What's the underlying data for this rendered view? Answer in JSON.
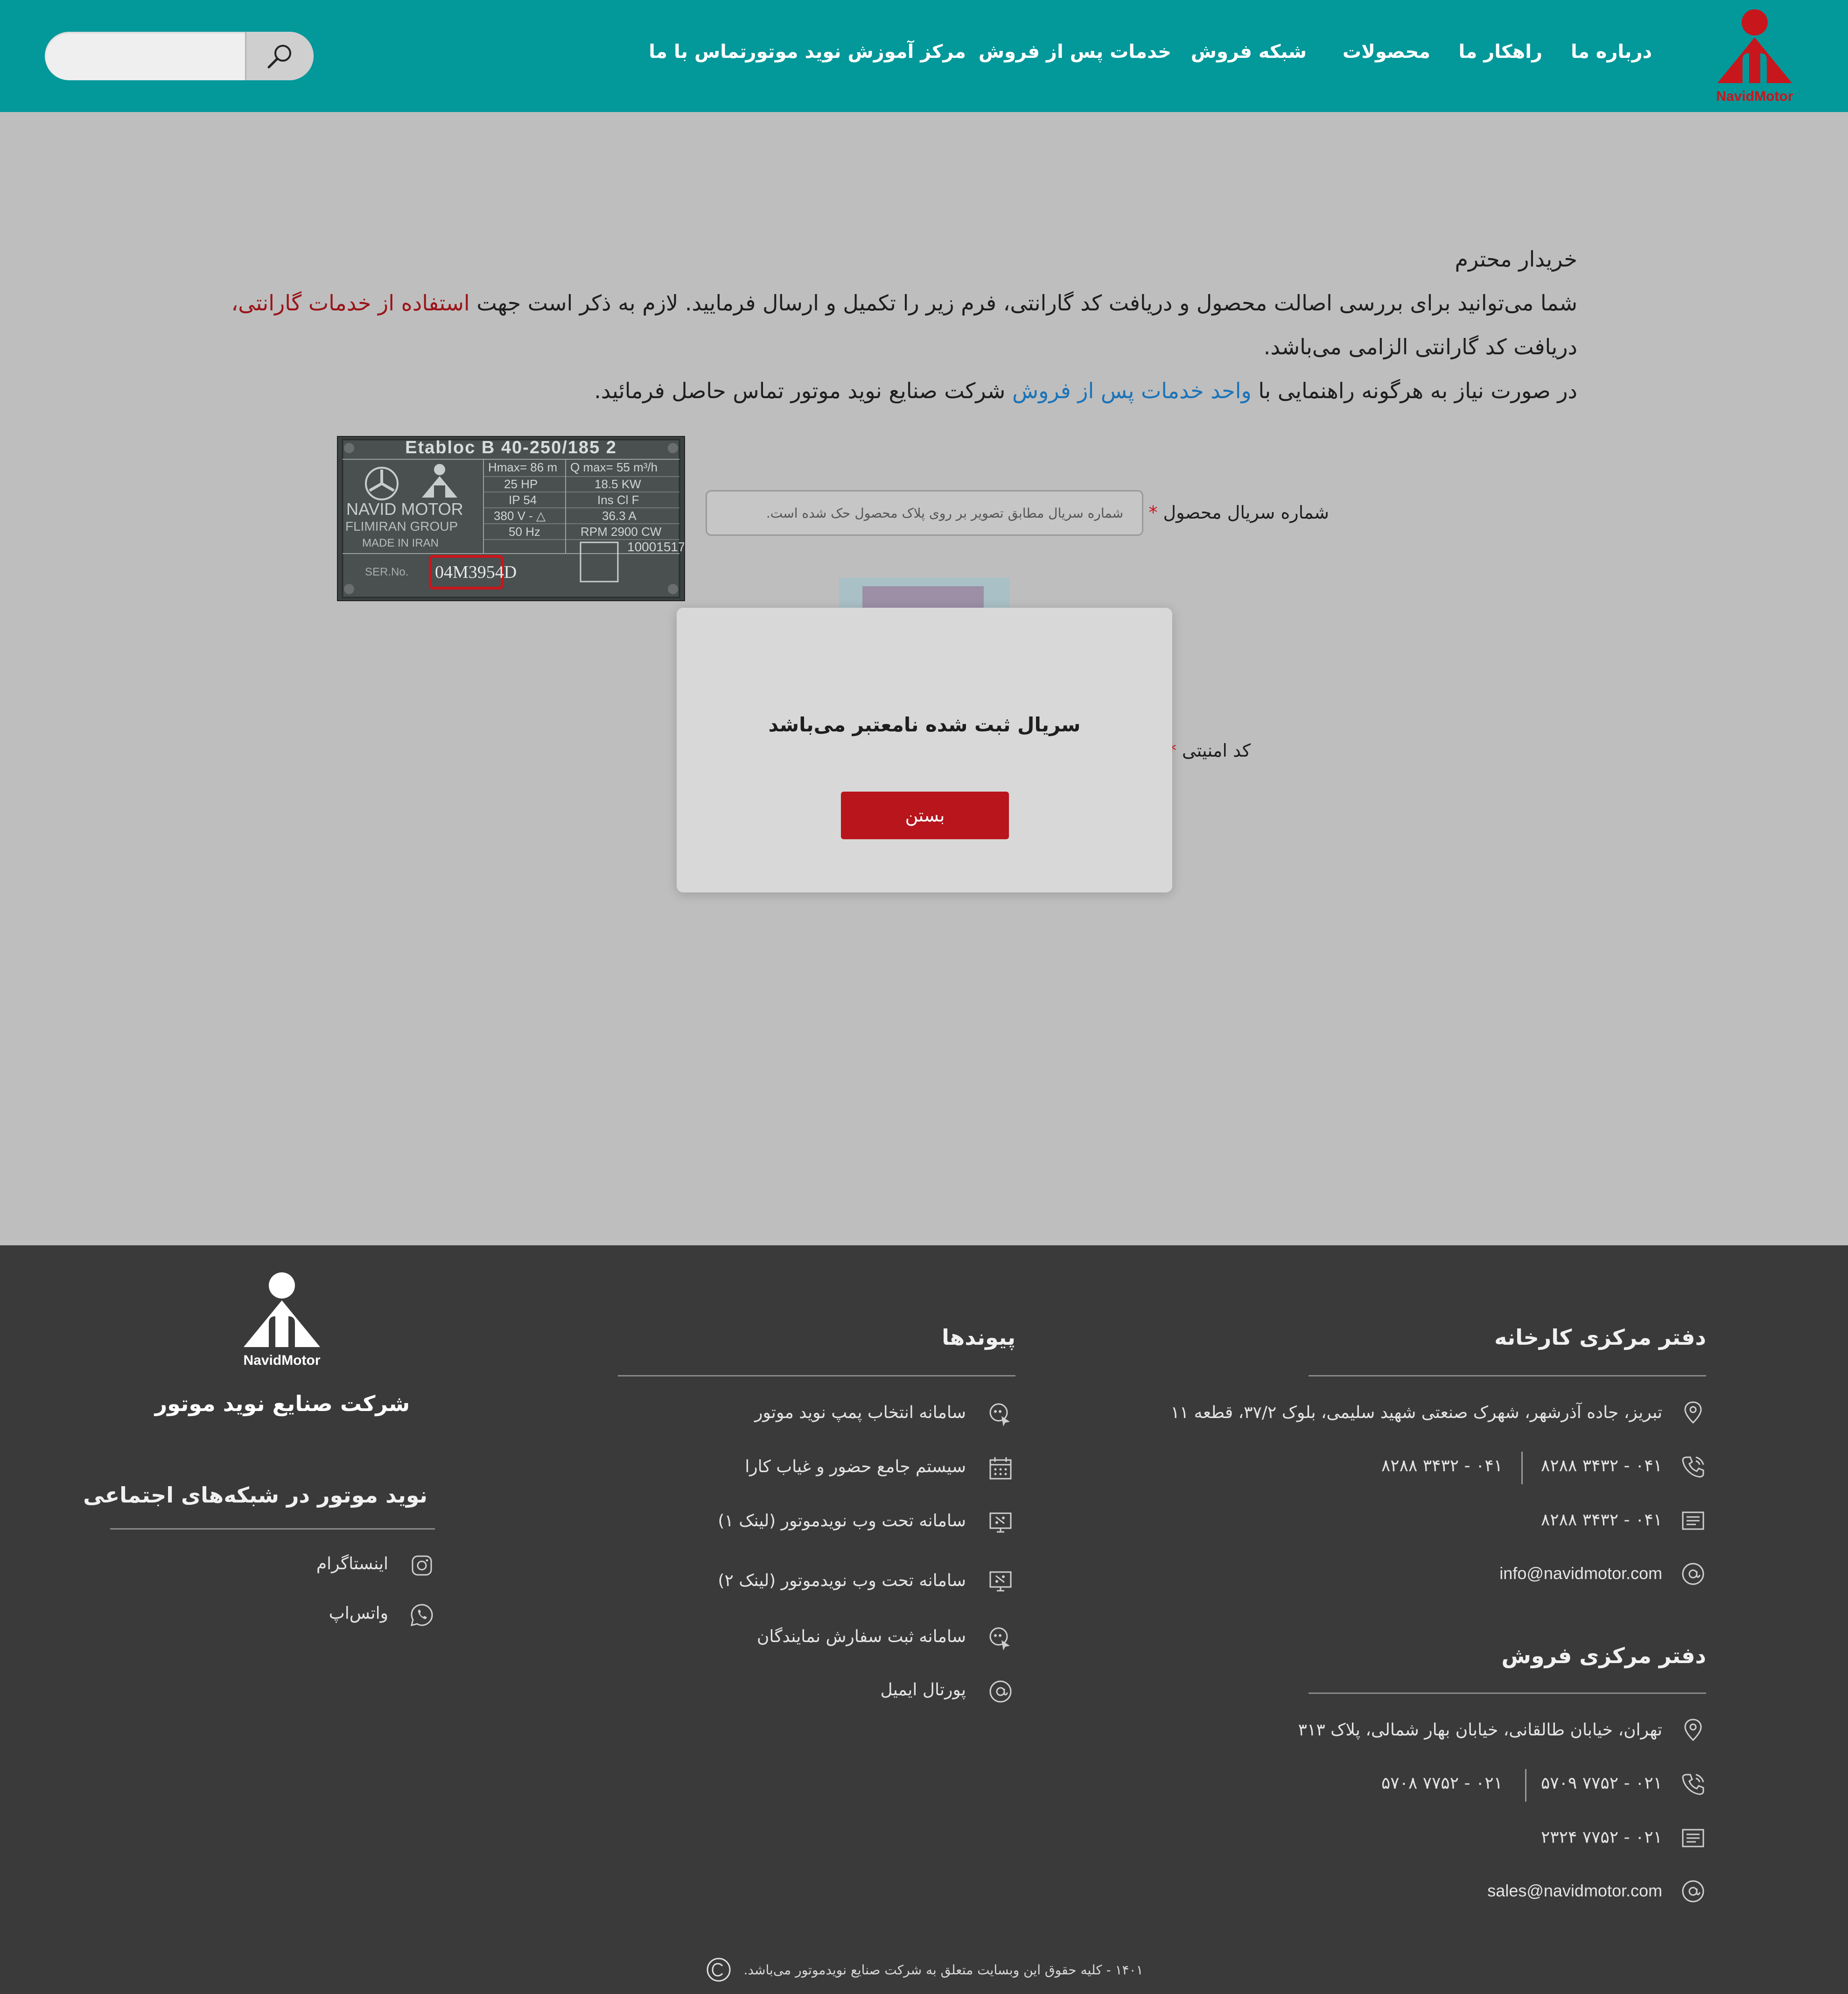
{
  "brand": {
    "logo_text": "NavidMotor",
    "primary_color": "#03989a",
    "accent_color": "#c8161d"
  },
  "nav": {
    "about": "درباره ما",
    "solutions": "راهکار ما",
    "products": "محصولات",
    "sales_network": "شبکه فروش",
    "after_sales": "خدمات پس از فروش",
    "training": "مرکز آموزش نوید موتور",
    "contact": "تماس با ما"
  },
  "search": {
    "placeholder": "",
    "icon": "search-icon"
  },
  "intro": {
    "greeting": "خریدار محترم",
    "line1_a": "شما می‌توانید برای بررسی اصالت محصول و دریافت کد گارانتی، فرم زیر را تکمیل و ارسال فرمایید. لازم به ذکر است جهت ",
    "line1_red": "استفاده از خدمات گارانتی،",
    "line2": "دریافت کد گارانتی الزامی می‌باشد.",
    "line3_a": "در صورت نیاز به هرگونه راهنمایی با ",
    "line3_link": "واحد خدمات پس از فروش",
    "line3_b": " شرکت صنایع نوید موتور تماس حاصل فرمائید."
  },
  "form": {
    "serial_label": "شماره سریال محصول",
    "required_mark": "*",
    "serial_placeholder": "شماره سریال مطابق تصویر بر روی پلاک محصول حک شده است.",
    "security_label": "کد امنیتی"
  },
  "plate": {
    "model": "Etabloc B 40-250/185 2",
    "brand": "NAVID MOTOR",
    "group": "FLIMIRAN GROUP",
    "made_in": "MADE IN IRAN",
    "ser_label": "SER.No.",
    "serial": "04M3954D",
    "specs_left": [
      "Hmax= 86 m",
      "25 HP",
      "IP 54",
      "380 V - △",
      "50 Hz"
    ],
    "specs_right": [
      "Q max= 55 m³/h",
      "18.5 KW",
      "Ins Cl F",
      "36.3 A",
      "RPM 2900 CW"
    ],
    "code": "10001517"
  },
  "modal": {
    "message": "سریال ثبت شده نامعتبر می‌باشد",
    "close_label": "بستن"
  },
  "footer": {
    "factory": {
      "title": "دفتر مرکزی کارخانه",
      "address": "تبریز، جاده آذرشهر، شهرک صنعتی شهید سلیمی، بلوک ۳۷/۲، قطعه ۱۱",
      "phone1": "۰۴۱ - ۳۴۳۲ ۸۲۸۸",
      "phone2": "۰۴۱ - ۳۴۳۲ ۸۲۸۸",
      "fax": "۰۴۱ - ۳۴۳۲ ۸۲۸۸",
      "email": "info@navidmotor.com"
    },
    "sales": {
      "title": "دفتر مرکزی فروش",
      "address": "تهران، خیابان طالقانی، خیابان بهار شمالی، پلاک ۳۱۳",
      "phone1": "۰۲۱ - ۷۷۵۲ ۵۷۰۹",
      "phone2": "۰۲۱ - ۷۷۵۲ ۵۷۰۸",
      "fax": "۰۲۱ - ۷۷۵۲ ۲۳۲۴",
      "email": "sales@navidmotor.com"
    },
    "links": {
      "title": "پیوندها",
      "items": [
        "سامانه انتخاب پمپ نوید موتور",
        "سیستم جامع حضور و غیاب کارا",
        "سامانه تحت وب نویدموتور (لینک ۱)",
        "سامانه تحت وب نویدموتور (لینک ۲)",
        "سامانه ثبت سفارش نمایندگان",
        "پورتال ایمیل"
      ]
    },
    "company": {
      "logo_text": "NavidMotor",
      "name": "شرکت صنایع نوید موتور",
      "social_title": "نوید موتور در شبکه‌های اجتماعی",
      "instagram": "اینستاگرام",
      "whatsapp": "واتس‌اپ"
    },
    "copyright": "۱۴۰۱ - کلیه حقوق این وبسایت متعلق به شرکت صنایع نویدموتور می‌باشد."
  }
}
